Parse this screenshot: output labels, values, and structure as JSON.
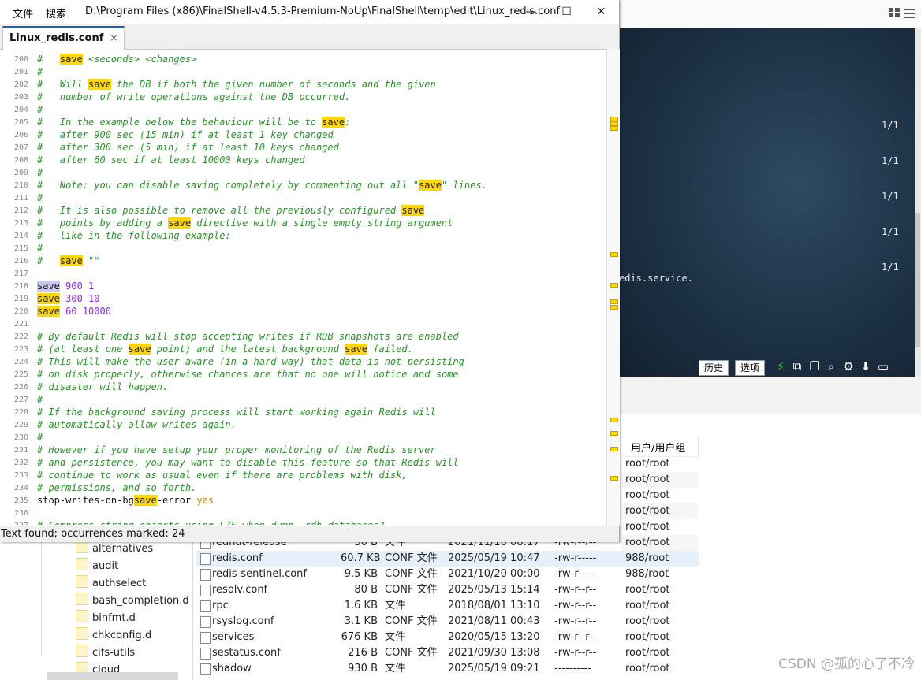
{
  "menu": {
    "file": "文件",
    "search": "搜索"
  },
  "window": {
    "title_path": "D:\\Program Files (x86)\\FinalShell-v4.5.3-Premium-NoUp\\FinalShell\\temp\\edit\\Linux_redis.conf",
    "minimize": "—",
    "maximize": "☐",
    "close": "✕"
  },
  "tab": {
    "label": "Linux_redis.conf",
    "close": "×"
  },
  "status": "Text found; occurrences marked: 24",
  "editor_lines": [
    {
      "n": "200",
      "s": [
        [
          "c",
          "#   "
        ],
        [
          "h",
          "save"
        ],
        [
          "c",
          " <seconds> <changes>"
        ]
      ]
    },
    {
      "n": "201",
      "s": [
        [
          "c",
          "#"
        ]
      ]
    },
    {
      "n": "202",
      "s": [
        [
          "c",
          "#   Will "
        ],
        [
          "h",
          "save"
        ],
        [
          "c",
          " the DB if both the given number of seconds and the given"
        ]
      ]
    },
    {
      "n": "203",
      "s": [
        [
          "c",
          "#   number of write operations against the DB occurred."
        ]
      ]
    },
    {
      "n": "204",
      "s": [
        [
          "c",
          "#"
        ]
      ]
    },
    {
      "n": "205",
      "s": [
        [
          "c",
          "#   In the example below the behaviour will be to "
        ],
        [
          "h",
          "save"
        ],
        [
          "c",
          ":"
        ]
      ]
    },
    {
      "n": "206",
      "s": [
        [
          "c",
          "#   after 900 sec (15 min) if at least 1 key changed"
        ]
      ]
    },
    {
      "n": "207",
      "s": [
        [
          "c",
          "#   after 300 sec (5 min) if at least 10 keys changed"
        ]
      ]
    },
    {
      "n": "208",
      "s": [
        [
          "c",
          "#   after 60 sec if at least 10000 keys changed"
        ]
      ]
    },
    {
      "n": "209",
      "s": [
        [
          "c",
          "#"
        ]
      ]
    },
    {
      "n": "210",
      "s": [
        [
          "c",
          "#   Note: you can disable saving completely by commenting out all \""
        ],
        [
          "h",
          "save"
        ],
        [
          "c",
          "\" lines."
        ]
      ]
    },
    {
      "n": "211",
      "s": [
        [
          "c",
          "#"
        ]
      ]
    },
    {
      "n": "212",
      "s": [
        [
          "c",
          "#   It is also possible to remove all the previously configured "
        ],
        [
          "h",
          "save"
        ]
      ]
    },
    {
      "n": "213",
      "s": [
        [
          "c",
          "#   points by adding a "
        ],
        [
          "h",
          "save"
        ],
        [
          "c",
          " directive with a single empty string argument"
        ]
      ]
    },
    {
      "n": "214",
      "s": [
        [
          "c",
          "#   like in the following example:"
        ]
      ]
    },
    {
      "n": "215",
      "s": [
        [
          "c",
          "#"
        ]
      ]
    },
    {
      "n": "216",
      "s": [
        [
          "c",
          "#   "
        ],
        [
          "h",
          "save"
        ],
        [
          "c",
          " \"\""
        ]
      ]
    },
    {
      "n": "217",
      "s": []
    },
    {
      "n": "218",
      "s": [
        [
          "b",
          "save"
        ],
        [
          "n",
          " 900 1"
        ]
      ]
    },
    {
      "n": "219",
      "s": [
        [
          "h",
          "save"
        ],
        [
          "n",
          " 300 10"
        ]
      ]
    },
    {
      "n": "220",
      "s": [
        [
          "h",
          "save"
        ],
        [
          "n",
          " 60 10000"
        ]
      ]
    },
    {
      "n": "221",
      "s": []
    },
    {
      "n": "222",
      "s": [
        [
          "c",
          "# By default Redis will stop accepting writes if RDB snapshots are enabled"
        ]
      ]
    },
    {
      "n": "223",
      "s": [
        [
          "c",
          "# (at least one "
        ],
        [
          "h",
          "save"
        ],
        [
          "c",
          " point) and the latest background "
        ],
        [
          "h",
          "save"
        ],
        [
          "c",
          " failed."
        ]
      ]
    },
    {
      "n": "224",
      "s": [
        [
          "c",
          "# This will make the user aware (in a hard way) that data is not persisting"
        ]
      ]
    },
    {
      "n": "225",
      "s": [
        [
          "c",
          "# on disk properly, otherwise chances are that no one will notice and some"
        ]
      ]
    },
    {
      "n": "226",
      "s": [
        [
          "c",
          "# disaster will happen."
        ]
      ]
    },
    {
      "n": "227",
      "s": [
        [
          "c",
          "#"
        ]
      ]
    },
    {
      "n": "228",
      "s": [
        [
          "c",
          "# If the background saving process will start working again Redis will"
        ]
      ]
    },
    {
      "n": "229",
      "s": [
        [
          "c",
          "# automatically allow writes again."
        ]
      ]
    },
    {
      "n": "230",
      "s": [
        [
          "c",
          "#"
        ]
      ]
    },
    {
      "n": "231",
      "s": [
        [
          "c",
          "# However if you have setup your proper monitoring of the Redis server"
        ]
      ]
    },
    {
      "n": "232",
      "s": [
        [
          "c",
          "# and persistence, you may want to disable this feature so that Redis will"
        ]
      ]
    },
    {
      "n": "233",
      "s": [
        [
          "c",
          "# continue to work as usual even if there are problems with disk,"
        ]
      ]
    },
    {
      "n": "234",
      "s": [
        [
          "c",
          "# permissions, and so forth."
        ]
      ]
    },
    {
      "n": "235",
      "s": [
        [
          "p",
          "stop-writes-on-bg"
        ],
        [
          "h",
          "save"
        ],
        [
          "p",
          "-error "
        ],
        [
          "v",
          "yes"
        ]
      ]
    },
    {
      "n": "236",
      "s": []
    },
    {
      "n": "237",
      "s": [
        [
          "c",
          "# Compress string objects using LZF when dump .rdb databases?"
        ]
      ]
    }
  ],
  "terminal": {
    "counts": [
      "1/1",
      "1/1",
      "1/1",
      "1/1",
      "1/1"
    ],
    "service_text": "edis.service."
  },
  "term_toolbar": {
    "history": "历史",
    "options": "选项"
  },
  "owner_header": "用户/用户组",
  "owners_upper": [
    "root/root",
    "root/root",
    "root/root",
    "root/root",
    "root/root"
  ],
  "tree_folders": [
    "alternatives",
    "audit",
    "authselect",
    "bash_completion.d",
    "binfmt.d",
    "chkconfig.d",
    "cifs-utils",
    "cloud"
  ],
  "files": [
    {
      "name": "redhat-release",
      "size": "30 B",
      "type": "文件",
      "date": "2021/11/10 08:17",
      "perm": "-rw-r--r--",
      "owner": "root/root"
    },
    {
      "name": "redis.conf",
      "size": "60.7 KB",
      "type": "CONF 文件",
      "date": "2025/05/19 10:47",
      "perm": "-rw-r-----",
      "owner": "988/root"
    },
    {
      "name": "redis-sentinel.conf",
      "size": "9.5 KB",
      "type": "CONF 文件",
      "date": "2021/10/20 00:00",
      "perm": "-rw-r-----",
      "owner": "988/root"
    },
    {
      "name": "resolv.conf",
      "size": "80 B",
      "type": "CONF 文件",
      "date": "2025/05/13 15:14",
      "perm": "-rw-r--r--",
      "owner": "root/root"
    },
    {
      "name": "rpc",
      "size": "1.6 KB",
      "type": "文件",
      "date": "2018/08/01 13:10",
      "perm": "-rw-r--r--",
      "owner": "root/root"
    },
    {
      "name": "rsyslog.conf",
      "size": "3.1 KB",
      "type": "CONF 文件",
      "date": "2021/08/11 00:43",
      "perm": "-rw-r--r--",
      "owner": "root/root"
    },
    {
      "name": "services",
      "size": "676 KB",
      "type": "文件",
      "date": "2020/05/15 13:20",
      "perm": "-rw-r--r--",
      "owner": "root/root"
    },
    {
      "name": "sestatus.conf",
      "size": "216 B",
      "type": "CONF 文件",
      "date": "2021/09/30 13:08",
      "perm": "-rw-r--r--",
      "owner": "root/root"
    },
    {
      "name": "shadow",
      "size": "930 B",
      "type": "文件",
      "date": "2025/05/19 09:21",
      "perm": "----------",
      "owner": "root/root"
    }
  ],
  "watermark": "CSDN @孤的心了不冷",
  "colors": {
    "highlight": "#ffd700",
    "comment": "#2f8f2f",
    "selection": "#c8c8f0",
    "tab_accent": "#0a64c8"
  }
}
